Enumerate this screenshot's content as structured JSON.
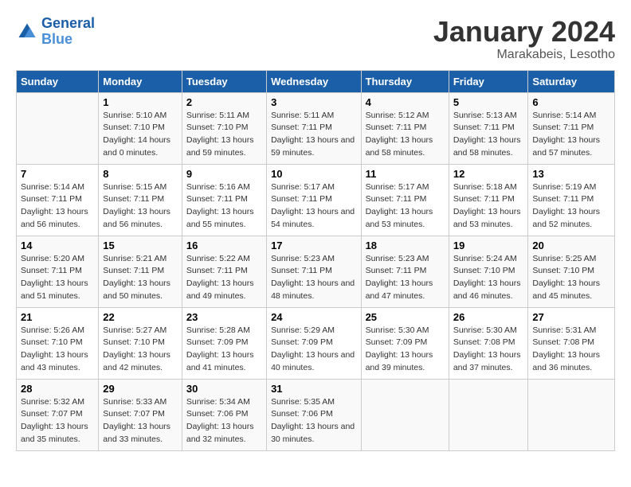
{
  "logo": {
    "line1": "General",
    "line2": "Blue"
  },
  "title": "January 2024",
  "subtitle": "Marakabeis, Lesotho",
  "weekdays": [
    "Sunday",
    "Monday",
    "Tuesday",
    "Wednesday",
    "Thursday",
    "Friday",
    "Saturday"
  ],
  "weeks": [
    [
      {
        "day": "",
        "sunrise": "",
        "sunset": "",
        "daylight": ""
      },
      {
        "day": "1",
        "sunrise": "Sunrise: 5:10 AM",
        "sunset": "Sunset: 7:10 PM",
        "daylight": "Daylight: 14 hours and 0 minutes."
      },
      {
        "day": "2",
        "sunrise": "Sunrise: 5:11 AM",
        "sunset": "Sunset: 7:10 PM",
        "daylight": "Daylight: 13 hours and 59 minutes."
      },
      {
        "day": "3",
        "sunrise": "Sunrise: 5:11 AM",
        "sunset": "Sunset: 7:11 PM",
        "daylight": "Daylight: 13 hours and 59 minutes."
      },
      {
        "day": "4",
        "sunrise": "Sunrise: 5:12 AM",
        "sunset": "Sunset: 7:11 PM",
        "daylight": "Daylight: 13 hours and 58 minutes."
      },
      {
        "day": "5",
        "sunrise": "Sunrise: 5:13 AM",
        "sunset": "Sunset: 7:11 PM",
        "daylight": "Daylight: 13 hours and 58 minutes."
      },
      {
        "day": "6",
        "sunrise": "Sunrise: 5:14 AM",
        "sunset": "Sunset: 7:11 PM",
        "daylight": "Daylight: 13 hours and 57 minutes."
      }
    ],
    [
      {
        "day": "7",
        "sunrise": "Sunrise: 5:14 AM",
        "sunset": "Sunset: 7:11 PM",
        "daylight": "Daylight: 13 hours and 56 minutes."
      },
      {
        "day": "8",
        "sunrise": "Sunrise: 5:15 AM",
        "sunset": "Sunset: 7:11 PM",
        "daylight": "Daylight: 13 hours and 56 minutes."
      },
      {
        "day": "9",
        "sunrise": "Sunrise: 5:16 AM",
        "sunset": "Sunset: 7:11 PM",
        "daylight": "Daylight: 13 hours and 55 minutes."
      },
      {
        "day": "10",
        "sunrise": "Sunrise: 5:17 AM",
        "sunset": "Sunset: 7:11 PM",
        "daylight": "Daylight: 13 hours and 54 minutes."
      },
      {
        "day": "11",
        "sunrise": "Sunrise: 5:17 AM",
        "sunset": "Sunset: 7:11 PM",
        "daylight": "Daylight: 13 hours and 53 minutes."
      },
      {
        "day": "12",
        "sunrise": "Sunrise: 5:18 AM",
        "sunset": "Sunset: 7:11 PM",
        "daylight": "Daylight: 13 hours and 53 minutes."
      },
      {
        "day": "13",
        "sunrise": "Sunrise: 5:19 AM",
        "sunset": "Sunset: 7:11 PM",
        "daylight": "Daylight: 13 hours and 52 minutes."
      }
    ],
    [
      {
        "day": "14",
        "sunrise": "Sunrise: 5:20 AM",
        "sunset": "Sunset: 7:11 PM",
        "daylight": "Daylight: 13 hours and 51 minutes."
      },
      {
        "day": "15",
        "sunrise": "Sunrise: 5:21 AM",
        "sunset": "Sunset: 7:11 PM",
        "daylight": "Daylight: 13 hours and 50 minutes."
      },
      {
        "day": "16",
        "sunrise": "Sunrise: 5:22 AM",
        "sunset": "Sunset: 7:11 PM",
        "daylight": "Daylight: 13 hours and 49 minutes."
      },
      {
        "day": "17",
        "sunrise": "Sunrise: 5:23 AM",
        "sunset": "Sunset: 7:11 PM",
        "daylight": "Daylight: 13 hours and 48 minutes."
      },
      {
        "day": "18",
        "sunrise": "Sunrise: 5:23 AM",
        "sunset": "Sunset: 7:11 PM",
        "daylight": "Daylight: 13 hours and 47 minutes."
      },
      {
        "day": "19",
        "sunrise": "Sunrise: 5:24 AM",
        "sunset": "Sunset: 7:10 PM",
        "daylight": "Daylight: 13 hours and 46 minutes."
      },
      {
        "day": "20",
        "sunrise": "Sunrise: 5:25 AM",
        "sunset": "Sunset: 7:10 PM",
        "daylight": "Daylight: 13 hours and 45 minutes."
      }
    ],
    [
      {
        "day": "21",
        "sunrise": "Sunrise: 5:26 AM",
        "sunset": "Sunset: 7:10 PM",
        "daylight": "Daylight: 13 hours and 43 minutes."
      },
      {
        "day": "22",
        "sunrise": "Sunrise: 5:27 AM",
        "sunset": "Sunset: 7:10 PM",
        "daylight": "Daylight: 13 hours and 42 minutes."
      },
      {
        "day": "23",
        "sunrise": "Sunrise: 5:28 AM",
        "sunset": "Sunset: 7:09 PM",
        "daylight": "Daylight: 13 hours and 41 minutes."
      },
      {
        "day": "24",
        "sunrise": "Sunrise: 5:29 AM",
        "sunset": "Sunset: 7:09 PM",
        "daylight": "Daylight: 13 hours and 40 minutes."
      },
      {
        "day": "25",
        "sunrise": "Sunrise: 5:30 AM",
        "sunset": "Sunset: 7:09 PM",
        "daylight": "Daylight: 13 hours and 39 minutes."
      },
      {
        "day": "26",
        "sunrise": "Sunrise: 5:30 AM",
        "sunset": "Sunset: 7:08 PM",
        "daylight": "Daylight: 13 hours and 37 minutes."
      },
      {
        "day": "27",
        "sunrise": "Sunrise: 5:31 AM",
        "sunset": "Sunset: 7:08 PM",
        "daylight": "Daylight: 13 hours and 36 minutes."
      }
    ],
    [
      {
        "day": "28",
        "sunrise": "Sunrise: 5:32 AM",
        "sunset": "Sunset: 7:07 PM",
        "daylight": "Daylight: 13 hours and 35 minutes."
      },
      {
        "day": "29",
        "sunrise": "Sunrise: 5:33 AM",
        "sunset": "Sunset: 7:07 PM",
        "daylight": "Daylight: 13 hours and 33 minutes."
      },
      {
        "day": "30",
        "sunrise": "Sunrise: 5:34 AM",
        "sunset": "Sunset: 7:06 PM",
        "daylight": "Daylight: 13 hours and 32 minutes."
      },
      {
        "day": "31",
        "sunrise": "Sunrise: 5:35 AM",
        "sunset": "Sunset: 7:06 PM",
        "daylight": "Daylight: 13 hours and 30 minutes."
      },
      {
        "day": "",
        "sunrise": "",
        "sunset": "",
        "daylight": ""
      },
      {
        "day": "",
        "sunrise": "",
        "sunset": "",
        "daylight": ""
      },
      {
        "day": "",
        "sunrise": "",
        "sunset": "",
        "daylight": ""
      }
    ]
  ]
}
